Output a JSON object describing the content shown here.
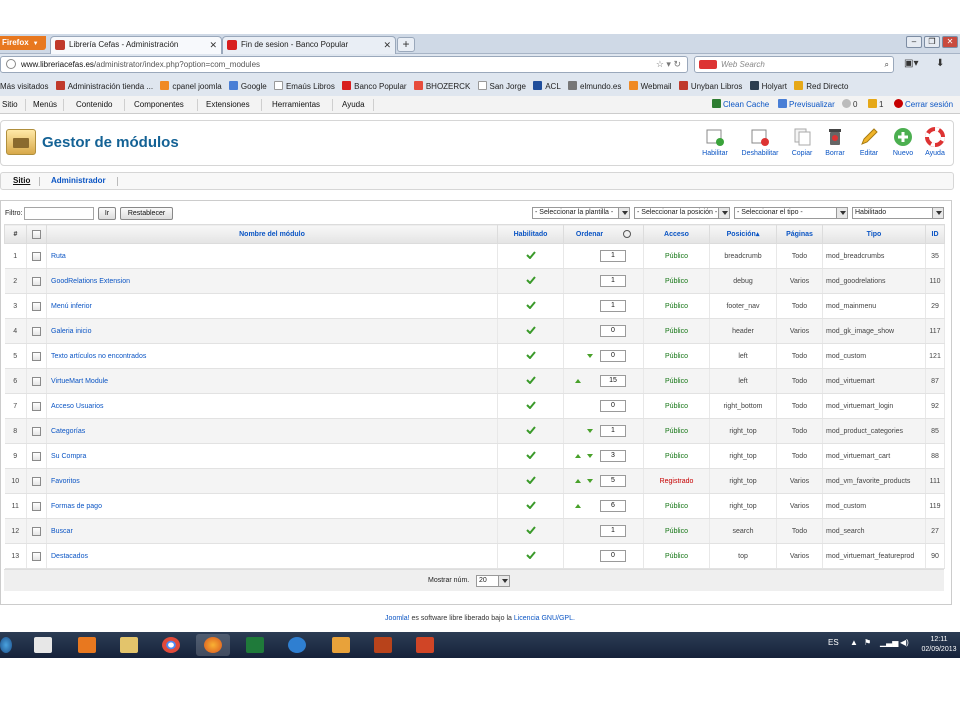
{
  "browser": {
    "app_button": "Firefox",
    "tabs": [
      {
        "label": "Librería Cefas - Administración",
        "active": true
      },
      {
        "label": "Fin de sesion - Banco Popular",
        "active": false
      }
    ],
    "url_domain": "www.libreriacefas.es",
    "url_path": "/administrator/index.php?option=com_modules",
    "search_placeholder": "Web Search",
    "bookmarks": [
      "Más visitados",
      "Administración tienda ...",
      "cpanel joomla",
      "Google",
      "Emaús Libros",
      "Banco Popular",
      "BHOZERCK",
      "San Jorge",
      "ACL",
      "elmundo.es",
      "Webmail",
      "Unyban Libros",
      "Holyart",
      "Red Directo"
    ]
  },
  "joomla_menu": {
    "items": [
      "Sitio",
      "Menús",
      "Contenido",
      "Componentes",
      "Extensiones",
      "Herramientas",
      "Ayuda"
    ],
    "clean_cache": "Clean Cache",
    "preview": "Previsualizar",
    "messages_count": "0",
    "users_count": "1",
    "logout": "Cerrar sesión"
  },
  "toolbar": {
    "title": "Gestor de módulos",
    "buttons": [
      "Habilitar",
      "Deshabilitar",
      "Copiar",
      "Borrar",
      "Editar",
      "Nuevo",
      "Ayuda"
    ]
  },
  "submenu": {
    "site": "Sitio",
    "admin": "Administrador"
  },
  "filters": {
    "label": "Filtro:",
    "go": "Ir",
    "reset": "Restablecer",
    "template_select": "- Seleccionar la plantilla -",
    "position_select": "- Seleccionar la posición -",
    "type_select": "- Seleccionar el tipo -",
    "state_select": "Habilitado"
  },
  "table": {
    "headers": {
      "num": "#",
      "name": "Nombre del módulo",
      "enabled": "Habilitado",
      "order": "Ordenar",
      "access": "Acceso",
      "position": "Posición",
      "pages": "Páginas",
      "type": "Tipo",
      "id": "ID"
    },
    "rows": [
      {
        "num": "1",
        "name": "Ruta",
        "up": false,
        "down": false,
        "order": "1",
        "access": "Público",
        "position": "breadcrumb",
        "pages": "Todo",
        "type": "mod_breadcrumbs",
        "id": "35"
      },
      {
        "num": "2",
        "name": "GoodRelations Extension",
        "up": false,
        "down": false,
        "order": "1",
        "access": "Público",
        "position": "debug",
        "pages": "Varios",
        "type": "mod_goodrelations",
        "id": "110"
      },
      {
        "num": "3",
        "name": "Menú inferior",
        "up": false,
        "down": false,
        "order": "1",
        "access": "Público",
        "position": "footer_nav",
        "pages": "Todo",
        "type": "mod_mainmenu",
        "id": "29"
      },
      {
        "num": "4",
        "name": "Galeria inicio",
        "up": false,
        "down": false,
        "order": "0",
        "access": "Público",
        "position": "header",
        "pages": "Varios",
        "type": "mod_gk_image_show",
        "id": "117"
      },
      {
        "num": "5",
        "name": "Texto artículos no encontrados",
        "up": false,
        "down": true,
        "order": "0",
        "access": "Público",
        "position": "left",
        "pages": "Todo",
        "type": "mod_custom",
        "id": "121"
      },
      {
        "num": "6",
        "name": "VirtueMart Module",
        "up": true,
        "down": false,
        "order": "15",
        "access": "Público",
        "position": "left",
        "pages": "Todo",
        "type": "mod_virtuemart",
        "id": "87"
      },
      {
        "num": "7",
        "name": "Acceso Usuarios",
        "up": false,
        "down": false,
        "order": "0",
        "access": "Público",
        "position": "right_bottom",
        "pages": "Todo",
        "type": "mod_virtuemart_login",
        "id": "92"
      },
      {
        "num": "8",
        "name": "Categorías",
        "up": false,
        "down": true,
        "order": "1",
        "access": "Público",
        "position": "right_top",
        "pages": "Todo",
        "type": "mod_product_categories",
        "id": "85"
      },
      {
        "num": "9",
        "name": "Su Compra",
        "up": true,
        "down": true,
        "order": "3",
        "access": "Público",
        "position": "right_top",
        "pages": "Todo",
        "type": "mod_virtuemart_cart",
        "id": "88"
      },
      {
        "num": "10",
        "name": "Favoritos",
        "up": true,
        "down": true,
        "order": "5",
        "access": "Registrado",
        "position": "right_top",
        "pages": "Varios",
        "type": "mod_vm_favorite_products",
        "id": "111"
      },
      {
        "num": "11",
        "name": "Formas de pago",
        "up": true,
        "down": false,
        "order": "6",
        "access": "Público",
        "position": "right_top",
        "pages": "Varios",
        "type": "mod_custom",
        "id": "119"
      },
      {
        "num": "12",
        "name": "Buscar",
        "up": false,
        "down": false,
        "order": "1",
        "access": "Público",
        "position": "search",
        "pages": "Todo",
        "type": "mod_search",
        "id": "27"
      },
      {
        "num": "13",
        "name": "Destacados",
        "up": false,
        "down": false,
        "order": "0",
        "access": "Público",
        "position": "top",
        "pages": "Varios",
        "type": "mod_virtuemart_featureprod",
        "id": "90"
      }
    ]
  },
  "pager": {
    "label": "Mostrar núm.",
    "value": "20"
  },
  "footer": {
    "joomla": "Joomla!",
    "text": " es software libre liberado bajo la ",
    "license": "Licencia GNU/GPL."
  },
  "taskbar": {
    "lang": "ES",
    "time": "12:11",
    "date": "02/09/2013"
  },
  "colors": {
    "link": "#0b55c4",
    "public": "#137513",
    "registered": "#c60000",
    "title": "#146295"
  }
}
